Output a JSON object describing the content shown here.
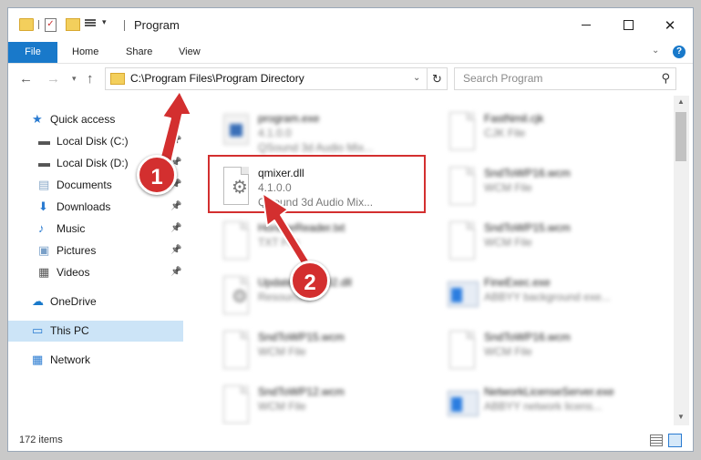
{
  "window": {
    "title": "Program"
  },
  "ribbon": {
    "tabs": [
      "File",
      "Home",
      "Share",
      "View"
    ]
  },
  "address": {
    "path": "C:\\Program Files\\Program Directory"
  },
  "search": {
    "placeholder": "Search Program"
  },
  "sidebar": {
    "items": [
      {
        "label": "Quick access",
        "icon": "star-icon",
        "pinned": false
      },
      {
        "label": "Local Disk (C:)",
        "icon": "drive-icon",
        "pinned": true
      },
      {
        "label": "Local Disk (D:)",
        "icon": "drive-icon",
        "pinned": true
      },
      {
        "label": "Documents",
        "icon": "documents-icon",
        "pinned": true
      },
      {
        "label": "Downloads",
        "icon": "download-icon",
        "pinned": true
      },
      {
        "label": "Music",
        "icon": "music-icon",
        "pinned": true
      },
      {
        "label": "Pictures",
        "icon": "pictures-icon",
        "pinned": true
      },
      {
        "label": "Videos",
        "icon": "videos-icon",
        "pinned": true
      },
      {
        "label": "OneDrive",
        "icon": "cloud-icon",
        "pinned": false
      },
      {
        "label": "This PC",
        "icon": "computer-icon",
        "pinned": false,
        "selected": true
      },
      {
        "label": "Network",
        "icon": "network-icon",
        "pinned": false
      }
    ]
  },
  "files": [
    {
      "name": "program.exe",
      "line2": "4.1.0.0",
      "line3": "QSound 3d Audio Mix...",
      "icon": "exe-icon",
      "blurred": true
    },
    {
      "name": "FastNmil.cjk",
      "line2": "CJK File",
      "line3": "",
      "icon": "file-icon",
      "blurred": true
    },
    {
      "name": "qmixer.dll",
      "line2": "4.1.0.0",
      "line3": "QSound 3d Audio Mix...",
      "icon": "dll-gear-icon",
      "blurred": false
    },
    {
      "name": "SndToWP16.wcm",
      "line2": "WCM File",
      "line3": "",
      "icon": "file-icon",
      "blurred": true
    },
    {
      "name": "HonlineReader.txt",
      "line2": "TXT File",
      "line3": "",
      "icon": "file-icon",
      "blurred": true
    },
    {
      "name": "SndToWP15.wcm",
      "line2": "WCM File",
      "line3": "",
      "icon": "file-icon",
      "blurred": true
    },
    {
      "name": "UpdateHelper32.dll",
      "line2": "Resources",
      "line3": "",
      "icon": "dll-gear-icon",
      "blurred": true
    },
    {
      "name": "FineExec.exe",
      "line2": "ABBYY background exe...",
      "line3": "",
      "icon": "app-icon",
      "blurred": true
    },
    {
      "name": "SndToWP15.wcm",
      "line2": "WCM File",
      "line3": "",
      "icon": "file-icon",
      "blurred": true
    },
    {
      "name": "SndToWP16.wcm",
      "line2": "WCM File",
      "line3": "",
      "icon": "file-icon",
      "blurred": true
    },
    {
      "name": "SndToWP12.wcm",
      "line2": "WCM File",
      "line3": "",
      "icon": "file-icon",
      "blurred": true
    },
    {
      "name": "NetworkLicenseServer.exe",
      "line2": "ABBYY network licens...",
      "line3": "",
      "icon": "app-icon",
      "blurred": true
    }
  ],
  "status": {
    "items_count": "172 items"
  },
  "callouts": [
    "1",
    "2"
  ],
  "colors": {
    "accent": "#1979ca",
    "highlight": "#d32f2f",
    "selected": "#cce4f7"
  }
}
